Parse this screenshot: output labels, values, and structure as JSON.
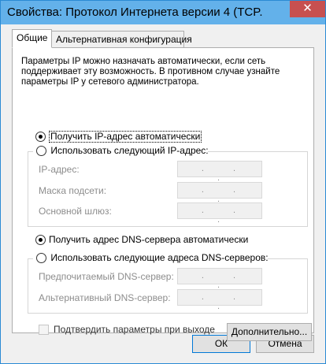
{
  "window": {
    "title": "Свойства: Протокол Интернета версии 4 (TCP...",
    "close_glyph": "✕"
  },
  "tabs": [
    {
      "label": "Общие",
      "active": true
    },
    {
      "label": "Альтернативная конфигурация",
      "active": false
    }
  ],
  "general": {
    "description": "Параметры IP можно назначать автоматически, если сеть поддерживает эту возможность. В противном случае узнайте параметры IP у сетевого администратора.",
    "ip_auto_label": "Получить IP-адрес автоматически",
    "ip_auto_checked": true,
    "ip_manual_label": "Использовать следующий IP-адрес:",
    "ip_manual_checked": false,
    "ip_address_label": "IP-адрес:",
    "subnet_mask_label": "Маска подсети:",
    "gateway_label": "Основной шлюз:",
    "ip_address_value": ".   .   .",
    "subnet_mask_value": ".   .   .",
    "gateway_value": ".   .   .",
    "dns_auto_label": "Получить адрес DNS-сервера автоматически",
    "dns_auto_checked": true,
    "dns_manual_label": "Использовать следующие адреса DNS-серверов:",
    "dns_manual_checked": false,
    "preferred_dns_label": "Предпочитаемый DNS-сервер:",
    "alternate_dns_label": "Альтернативный DNS-сервер:",
    "preferred_dns_value": ".   .   .",
    "alternate_dns_value": ".   .   .",
    "validate_label": "Подтвердить параметры при выходе",
    "validate_checked": false,
    "advanced_button": "Дополнительно..."
  },
  "footer": {
    "ok_button": "ОК",
    "cancel_button": "Отмена"
  },
  "colors": {
    "titlebar": "#63b1ea",
    "close": "#c75050",
    "annotation_arrow": "#cc0000"
  }
}
